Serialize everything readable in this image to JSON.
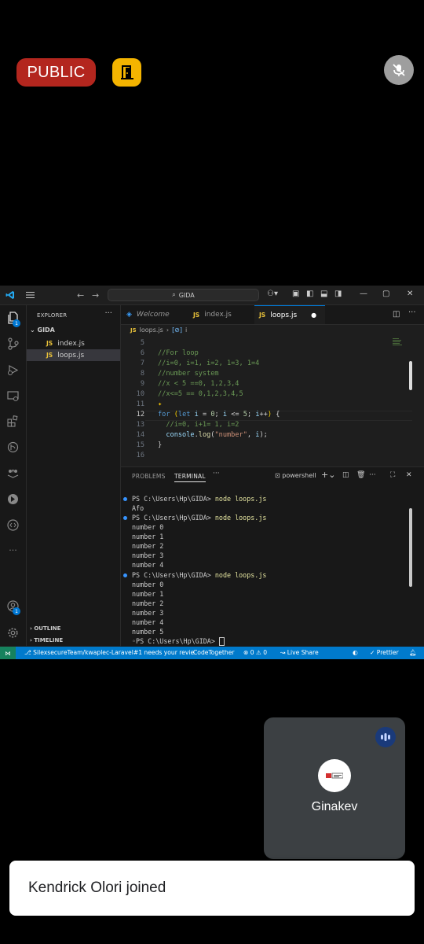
{
  "meeting": {
    "visibility_label": "PUBLIC",
    "participant": {
      "name": "Ginakev"
    },
    "toast": "Kendrick Olori joined"
  },
  "vscode": {
    "search": "GIDA",
    "explorer": {
      "title": "EXPLORER",
      "folder": "GIDA",
      "files": [
        {
          "name": "index.js",
          "active": false
        },
        {
          "name": "loops.js",
          "active": true
        }
      ],
      "outline": "OUTLINE",
      "timeline": "TIMELINE"
    },
    "tabs": [
      {
        "label": "Welcome"
      },
      {
        "label": "index.js"
      },
      {
        "label": "loops.js"
      }
    ],
    "breadcrumb": {
      "file": "loops.js",
      "symbol": "i"
    },
    "accounts_badge": "1",
    "explorer_badge": "1",
    "line_numbers": [
      "5",
      "6",
      "7",
      "8",
      "9",
      "10",
      "11",
      "12",
      "13",
      "14",
      "15",
      "16"
    ],
    "panel": {
      "tabs": [
        "PROBLEMS",
        "TERMINAL"
      ],
      "shell": "powershell"
    },
    "terminal": {
      "prompt": "PS C:\\Users\\Hp\\GIDA> ",
      "command": "node loops.js",
      "first_output": "Afo",
      "run2": [
        "number 0",
        "number 1",
        "number 2",
        "number 3",
        "number 4"
      ],
      "run3": [
        "number 0",
        "number 1",
        "number 2",
        "number 3",
        "number 4",
        "number 5"
      ]
    },
    "status": {
      "branch": "SilexsecureTeam/kwaplec-Laravel#1 needs your revie",
      "codetogether": "CodeTogether",
      "errors": "0",
      "warnings": "0",
      "liveshare": "Live Share",
      "prettier": "Prettier"
    }
  },
  "colors": {
    "public": "#b3261e",
    "exit": "#f4b400",
    "vscode_blue": "#007acc"
  }
}
